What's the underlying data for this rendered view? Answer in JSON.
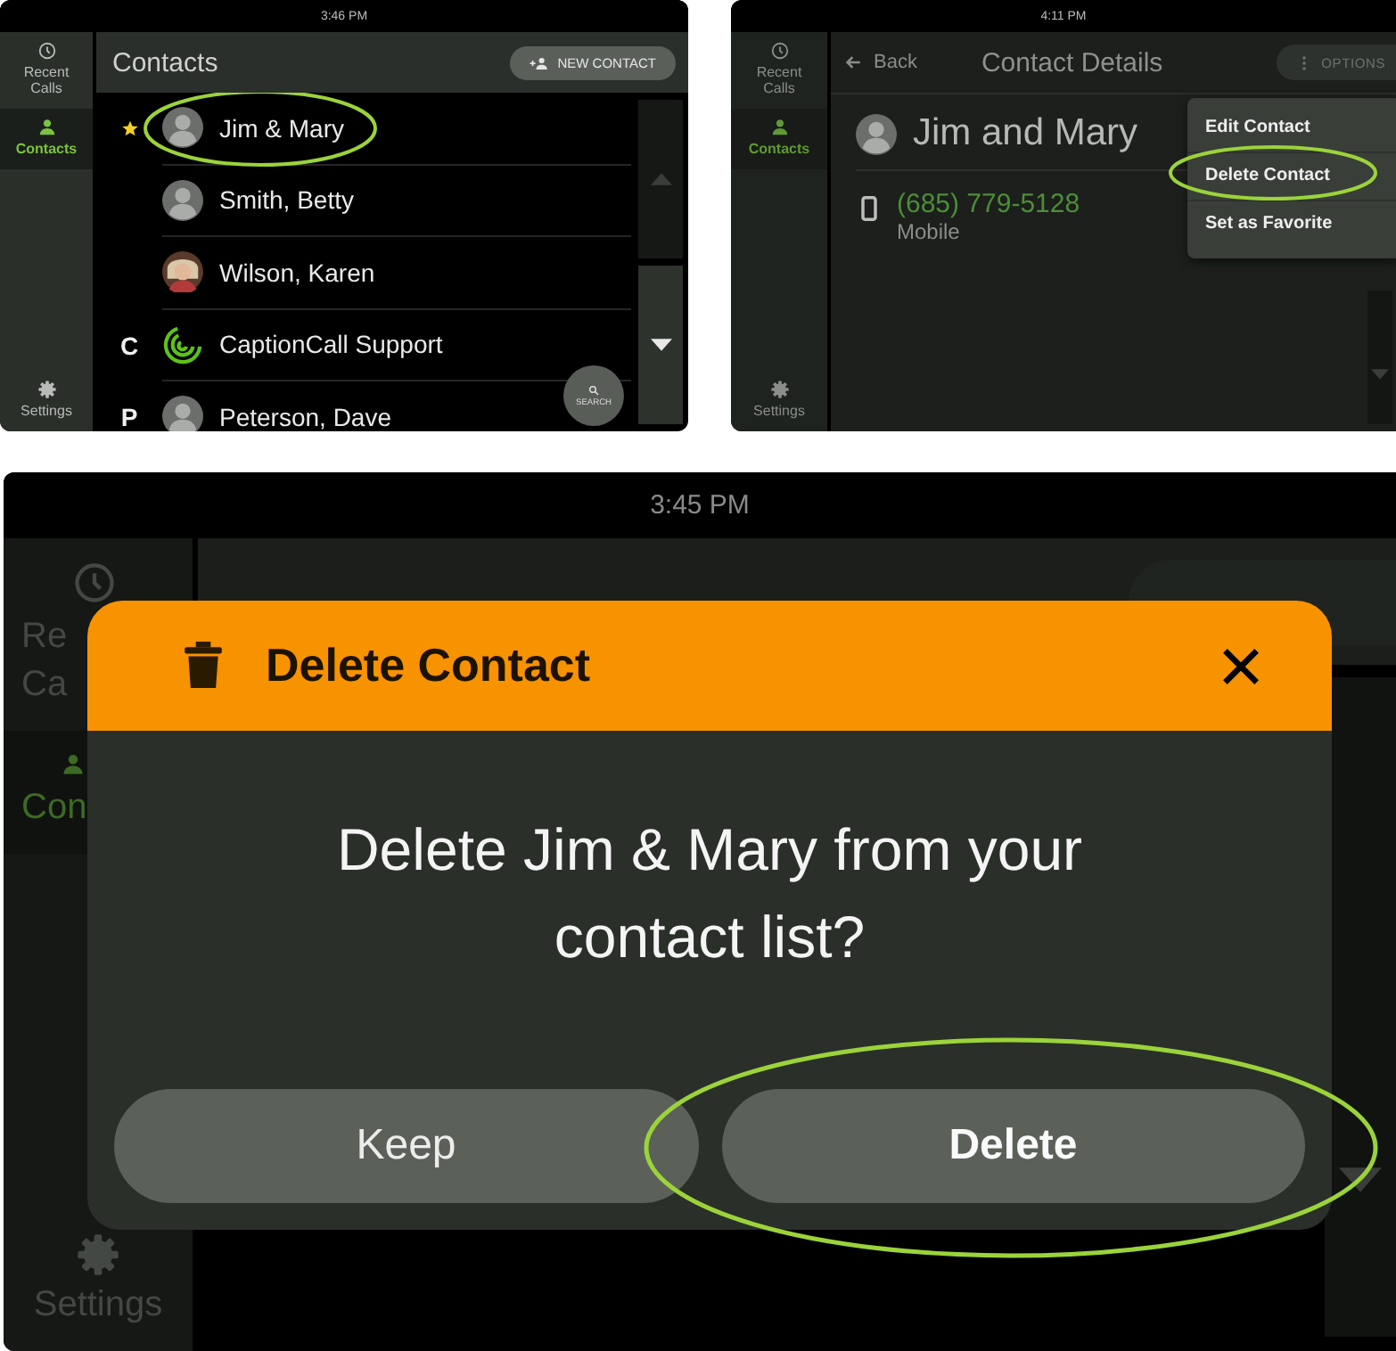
{
  "screens": [
    {
      "kind": "contacts",
      "time": "3:46 PM",
      "nav": [
        {
          "kind": "clock",
          "lines": [
            "Recent",
            "Calls"
          ],
          "selected": false
        },
        {
          "kind": "person",
          "lines": [
            "Contacts"
          ],
          "selected": true
        },
        {
          "kind": "gear",
          "lines": [
            "Settings"
          ],
          "selected": false
        }
      ],
      "title": "Contacts",
      "new_contact_button": "NEW CONTACT",
      "contacts": [
        {
          "favorite": true,
          "kind": "silhouette",
          "name": "Jim & Mary",
          "circled": true
        },
        {
          "favorite": false,
          "kind": "silhouette",
          "name": "Smith, Betty",
          "circled": false
        },
        {
          "favorite": false,
          "name": "Wilson, Karen",
          "circled": false
        },
        {
          "index": "C",
          "favorite": false,
          "kind": "logo",
          "name": "CaptionCall Support",
          "circled": false
        },
        {
          "index": "P",
          "favorite": false,
          "kind": "silhouette",
          "name": "Peterson, Dave",
          "circled": false
        }
      ],
      "scroll_buttons": [
        {
          "kind": "up",
          "disabled": true
        },
        {
          "kind": "down",
          "disabled": false
        }
      ],
      "search_button": "SEARCH"
    },
    {
      "kind": "details",
      "time": "4:11 PM",
      "nav": [
        {
          "kind": "clock",
          "lines": [
            "Recent",
            "Calls"
          ],
          "selected": false
        },
        {
          "kind": "person",
          "lines": [
            "Contacts"
          ],
          "selected": true
        },
        {
          "kind": "gear",
          "lines": [
            "Settings"
          ],
          "selected": false
        }
      ],
      "back_button": "Back",
      "title": "Contact Details",
      "options_button": "OPTIONS",
      "name": "Jim and Mary",
      "phone": "(685) 779-5128",
      "phone_type": "Mobile",
      "menu": [
        {
          "label": "Edit Contact",
          "circled": false
        },
        {
          "label": "Delete Contact",
          "circled": true
        },
        {
          "label": "Set as Favorite",
          "circled": false
        }
      ]
    },
    {
      "kind": "dialog",
      "time": "3:45 PM",
      "nav": [
        {
          "kind": "clock",
          "lines": [
            "Re",
            "Ca"
          ],
          "selected": false
        },
        {
          "kind": "person",
          "lines": [
            "Con"
          ],
          "selected": true
        },
        {
          "kind": "gear",
          "lines": [
            "Settings"
          ],
          "selected": false
        }
      ],
      "dialog": {
        "title": "Delete Contact",
        "message": "Delete Jim & Mary from your contact list?",
        "buttons": [
          {
            "label": "Keep",
            "primary": false,
            "circled": false
          },
          {
            "label": "Delete",
            "primary": true,
            "circled": true
          }
        ]
      }
    }
  ]
}
